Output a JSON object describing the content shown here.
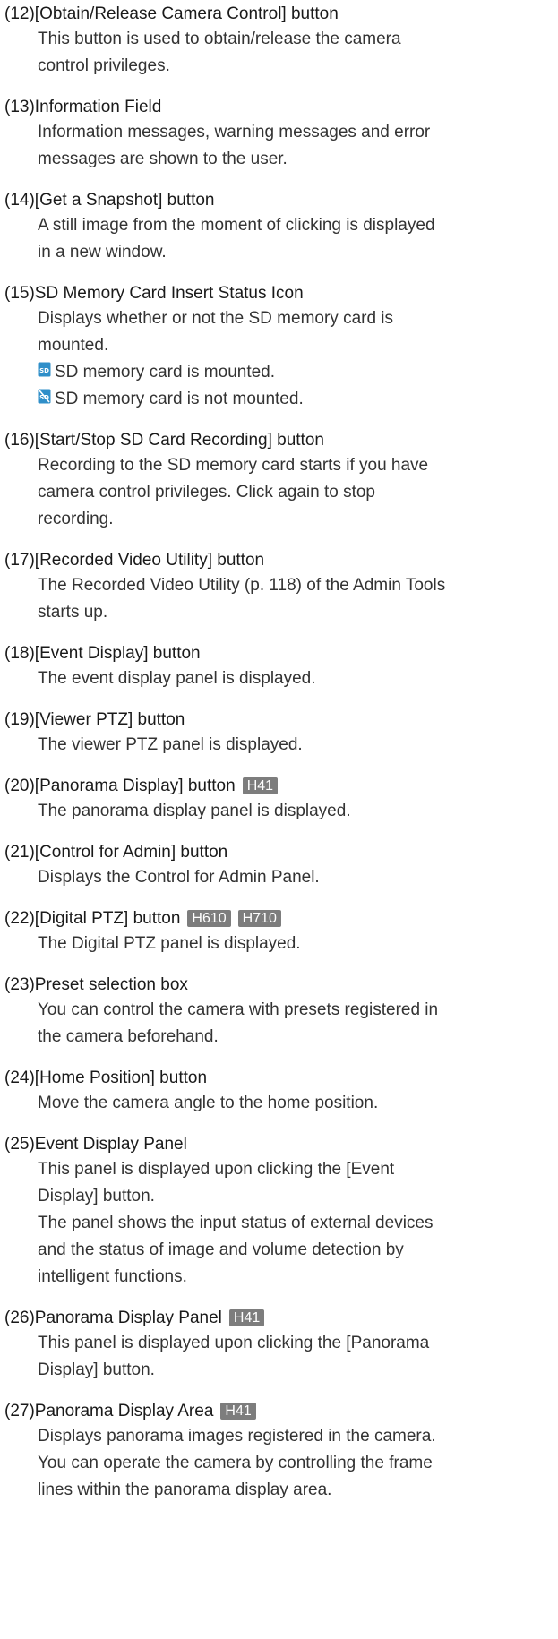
{
  "entries": [
    {
      "title": "(12)[Obtain/Release Camera Control] button",
      "lines": [
        "This button is used to obtain/release the camera",
        "control privileges."
      ]
    },
    {
      "title": "(13)Information Field",
      "lines": [
        "Information messages, warning messages and error",
        "messages are shown to the user."
      ]
    },
    {
      "title": "(14)[Get a Snapshot] button",
      "lines": [
        "A still image from the moment of clicking is displayed",
        "in a new window."
      ]
    },
    {
      "title": "(15)SD Memory Card Insert Status Icon",
      "lines": [
        "Displays whether or not the SD memory card is",
        "mounted."
      ],
      "icon_lines": [
        {
          "icon": "sd-card-mounted-icon",
          "text": "SD memory card is mounted."
        },
        {
          "icon": "sd-card-not-mounted-icon",
          "text": "SD memory card is not mounted."
        }
      ]
    },
    {
      "title": "(16)[Start/Stop SD Card Recording] button",
      "lines": [
        "Recording to the SD memory card starts if you have",
        "camera control privileges. Click again to stop",
        "recording."
      ]
    },
    {
      "title": "(17)[Recorded Video Utility] button",
      "lines": [
        "The Recorded Video Utility (p. 118) of the Admin Tools",
        "starts up."
      ]
    },
    {
      "title": "(18)[Event Display] button",
      "lines": [
        "The event display panel is displayed."
      ]
    },
    {
      "title": "(19)[Viewer PTZ] button",
      "lines": [
        "The viewer PTZ panel is displayed."
      ]
    },
    {
      "title": "(20)[Panorama Display] button",
      "badges": [
        "H41"
      ],
      "lines": [
        "The panorama display panel is displayed."
      ]
    },
    {
      "title": "(21)[Control for Admin] button",
      "lines": [
        "Displays the Control for Admin Panel."
      ]
    },
    {
      "title": "(22)[Digital PTZ] button",
      "badges": [
        "H610",
        "H710"
      ],
      "lines": [
        "The Digital PTZ panel is displayed."
      ]
    },
    {
      "title": "(23)Preset selection box",
      "lines": [
        "You can control the camera with presets registered in",
        "the camera beforehand."
      ]
    },
    {
      "title": "(24)[Home Position] button",
      "lines": [
        "Move the camera angle to the home position."
      ]
    },
    {
      "title": "(25)Event Display Panel",
      "lines": [
        "This panel is displayed upon clicking the [Event",
        "Display] button.",
        "The panel shows the input status of external devices",
        "and the status of image and volume detection by",
        "intelligent functions."
      ]
    },
    {
      "title": "(26)Panorama Display Panel",
      "badges": [
        "H41"
      ],
      "lines": [
        "This panel is displayed upon clicking the [Panorama",
        "Display] button."
      ]
    },
    {
      "title": "(27)Panorama Display Area",
      "badges": [
        "H41"
      ],
      "lines": [
        "Displays panorama images registered in the camera.",
        "You can operate the camera by controlling the frame",
        "lines within the panorama display area."
      ]
    }
  ],
  "colors": {
    "badge_bg": "#7d7d7d",
    "badge_text": "#ffffff",
    "sd_icon_blue": "#2f8fc9"
  }
}
